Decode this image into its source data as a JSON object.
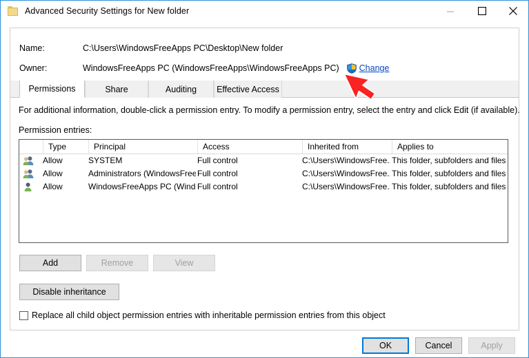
{
  "window": {
    "title": "Advanced Security Settings for New folder",
    "icon": "folder-icon",
    "border_color": "#2b90d9",
    "controls": {
      "minimize": "minimize-icon",
      "maximize": "maximize-icon",
      "close": "close-icon"
    }
  },
  "header": {
    "name_label": "Name:",
    "name_value": "C:\\Users\\WindowsFreeApps PC\\Desktop\\New folder",
    "owner_label": "Owner:",
    "owner_value": "WindowsFreeApps PC (WindowsFreeApps\\WindowsFreeApps PC)",
    "change_link": "Change",
    "change_icon": "uac-shield-icon",
    "link_color": "#0645c1"
  },
  "tabs": [
    {
      "label": "Permissions",
      "active": true
    },
    {
      "label": "Share",
      "active": false
    },
    {
      "label": "Auditing",
      "active": false
    },
    {
      "label": "Effective Access",
      "active": false
    }
  ],
  "main": {
    "info_text": "For additional information, double-click a permission entry. To modify a permission entry, select the entry and click Edit (if available).",
    "entries_label": "Permission entries:"
  },
  "table": {
    "columns": [
      "Type",
      "Principal",
      "Access",
      "Inherited from",
      "Applies to"
    ],
    "rows": [
      {
        "icon": "group-icon",
        "type": "Allow",
        "principal": "SYSTEM",
        "access": "Full control",
        "inherited_from": "C:\\Users\\WindowsFree...",
        "applies_to": "This folder, subfolders and files"
      },
      {
        "icon": "group-icon",
        "type": "Allow",
        "principal": "Administrators (WindowsFree...",
        "access": "Full control",
        "inherited_from": "C:\\Users\\WindowsFree...",
        "applies_to": "This folder, subfolders and files"
      },
      {
        "icon": "user-icon",
        "type": "Allow",
        "principal": "WindowsFreeApps PC (Windo...",
        "access": "Full control",
        "inherited_from": "C:\\Users\\WindowsFree...",
        "applies_to": "This folder, subfolders and files"
      }
    ]
  },
  "buttons": {
    "add": "Add",
    "remove": "Remove",
    "view": "View",
    "disable_inheritance": "Disable inheritance",
    "ok": "OK",
    "cancel": "Cancel",
    "apply": "Apply"
  },
  "checkbox": {
    "label": "Replace all child object permission entries with inheritable permission entries from this object",
    "checked": false
  },
  "annotation": {
    "type": "red-arrow",
    "color": "#fb2222",
    "points_to": "Change"
  }
}
